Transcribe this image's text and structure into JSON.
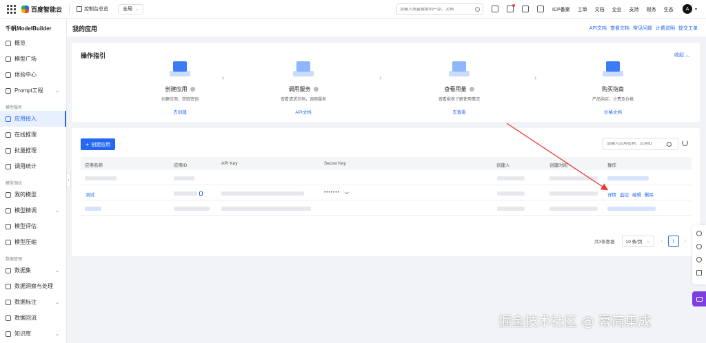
{
  "topbar": {
    "logo_text": "百度智能云",
    "console_home": "控制台总览",
    "region": "全局",
    "search_placeholder": "请输入想要搜索的产品、文档",
    "menu": [
      "ICP备案",
      "工单",
      "文档",
      "企业",
      "支持",
      "财务",
      "生态"
    ],
    "avatar_letter": "A"
  },
  "sidebar": {
    "title": "千帆ModelBuilder",
    "top_items": [
      {
        "label": "概览"
      },
      {
        "label": "模型广场"
      },
      {
        "label": "体验中心"
      },
      {
        "label": "Prompt工程"
      }
    ],
    "groups": [
      {
        "label": "模型服务",
        "items": [
          {
            "label": "应用接入"
          },
          {
            "label": "在线推理"
          },
          {
            "label": "批量推理"
          },
          {
            "label": "调用统计"
          }
        ]
      },
      {
        "label": "模型调优",
        "items": [
          {
            "label": "我的模型"
          },
          {
            "label": "模型精调"
          },
          {
            "label": "模型评估"
          },
          {
            "label": "模型压缩"
          }
        ]
      },
      {
        "label": "数据管理",
        "items": [
          {
            "label": "数据集"
          },
          {
            "label": "数据洞察与处理"
          },
          {
            "label": "数据标注"
          },
          {
            "label": "数据回流"
          },
          {
            "label": "知识库"
          }
        ]
      }
    ]
  },
  "header": {
    "title": "我的应用",
    "links": [
      "API文档",
      "查看文档",
      "常见问题",
      "计费说明",
      "提交工单"
    ]
  },
  "guide": {
    "title": "操作指引",
    "collapse_label": "收起",
    "steps": [
      {
        "name": "创建应用",
        "desc": "创建应用，获取密钥",
        "link": "去创建"
      },
      {
        "name": "调用服务",
        "desc": "查看请求示例，调用服务",
        "link": "API文档"
      },
      {
        "name": "查看用量",
        "desc": "查看报表了解使用情况",
        "link": "去查看"
      },
      {
        "name": "购买指南",
        "desc": "产品购买，计费及价格",
        "link": "价格文档"
      }
    ]
  },
  "table": {
    "create_button": "创建应用",
    "search_placeholder": "请输入应用名称、应用ID",
    "columns": [
      "应用名称",
      "应用ID",
      "API Key",
      "Secret Key",
      "创建人",
      "创建时间",
      "操作"
    ],
    "visible_row": {
      "name": "测试",
      "secret_mask": "•••••••",
      "actions": [
        "详情",
        "监控",
        "编辑",
        "删除"
      ]
    },
    "total_text": "共3条数据",
    "page_size": "10 条/页",
    "current_page": "1"
  },
  "watermark": "掘金技术社区 @ 幂简集成",
  "colors": {
    "primary": "#2468f2",
    "annotation_arrow": "#e53935",
    "chat_float": "#7b3fe4"
  }
}
